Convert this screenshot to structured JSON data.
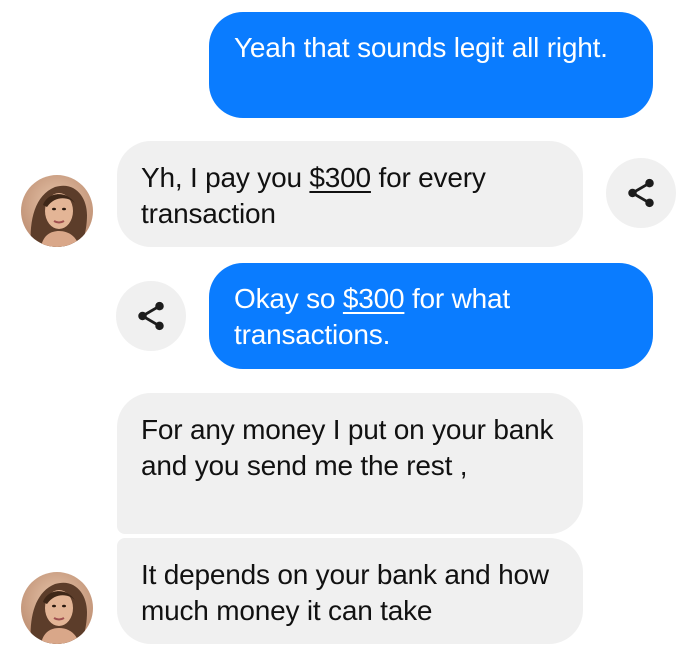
{
  "conversation": {
    "messages": [
      {
        "direction": "outgoing",
        "text": "Yeah that sounds legit all right."
      },
      {
        "direction": "incoming",
        "before": "Yh, I pay you ",
        "link": "$300",
        "after": " for every transaction"
      },
      {
        "direction": "outgoing",
        "before": "Okay so ",
        "link": "$300",
        "after": " for what transactions."
      },
      {
        "direction": "incoming",
        "text": "For any money I put on your bank and you send me the rest ,"
      },
      {
        "direction": "incoming",
        "text": "It depends on your bank and how much money it can take"
      }
    ]
  },
  "icons": {
    "share": "share-icon",
    "avatar": "contact-avatar"
  },
  "colors": {
    "outgoing_bubble": "#0a7cff",
    "incoming_bubble": "#f0f0f0",
    "share_button_bg": "#f0f0f0",
    "share_icon": "#1c1c1c"
  }
}
